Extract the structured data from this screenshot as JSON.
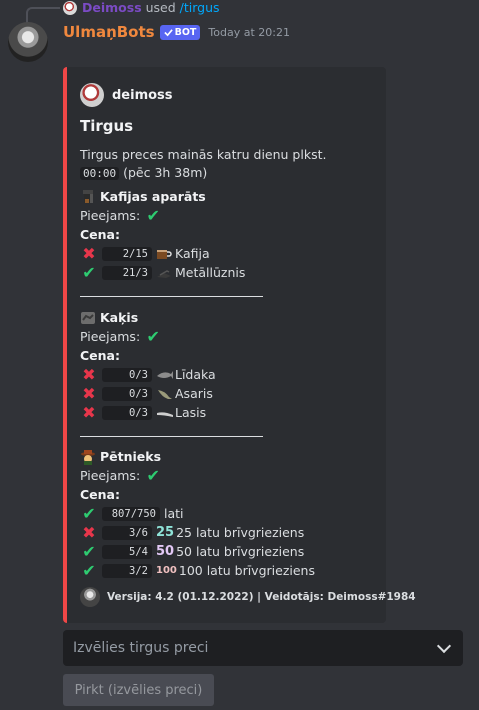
{
  "reply": {
    "user": "Deimoss",
    "used": "used",
    "command": "/tirgus"
  },
  "author": {
    "name": "UlmaņBots",
    "badge": "BOT",
    "timestamp": "Today at 20:21"
  },
  "embed": {
    "accent_color": "#f04747",
    "author_name": "deimoss",
    "title": "Tirgus",
    "description_line1": "Tirgus preces mainās katru dienu plkst.",
    "description_time": "00:00",
    "description_remaining": "(pēc 3h 38m)",
    "items": [
      {
        "name": "Kafijas aparāts",
        "icon": "coffee-machine-icon",
        "available_label": "Pieejams:",
        "price_label": "Cena:",
        "costs": [
          {
            "ok": false,
            "amount": "2/15",
            "resource": "Kafija",
            "icon": "coffee-cup-icon"
          },
          {
            "ok": true,
            "amount": "21/3",
            "resource": "Metāllūznis",
            "icon": "scrap-metal-icon"
          }
        ]
      },
      {
        "name": "Kaķis",
        "icon": "cat-icon",
        "available_label": "Pieejams:",
        "price_label": "Cena:",
        "costs": [
          {
            "ok": false,
            "amount": "0/3",
            "resource": "Līdaka",
            "icon": "pike-fish-icon"
          },
          {
            "ok": false,
            "amount": "0/3",
            "resource": "Asaris",
            "icon": "perch-fish-icon"
          },
          {
            "ok": false,
            "amount": "0/3",
            "resource": "Lasis",
            "icon": "salmon-fish-icon"
          }
        ]
      },
      {
        "name": "Pētnieks",
        "icon": "explorer-icon",
        "available_label": "Pieejams:",
        "price_label": "Cena:",
        "costs": [
          {
            "ok": true,
            "amount": "807/750",
            "resource": "lati",
            "icon": ""
          },
          {
            "ok": false,
            "amount": "3/6",
            "resource": "25 latu brīvgrieziens",
            "icon": "25-badge-icon",
            "badge": "25"
          },
          {
            "ok": true,
            "amount": "5/4",
            "resource": "50 latu brīvgrieziens",
            "icon": "50-badge-icon",
            "badge": "50"
          },
          {
            "ok": true,
            "amount": "3/2",
            "resource": "100 latu brīvgrieziens",
            "icon": "100-badge-icon",
            "badge": "100"
          }
        ]
      }
    ],
    "footer": "Versija: 4.2 (01.12.2022)  |  Veidotājs: Deimoss#1984"
  },
  "select": {
    "placeholder": "Izvēlies tirgus preci"
  },
  "buy_button": {
    "label": "Pirkt (izvēlies preci)"
  }
}
